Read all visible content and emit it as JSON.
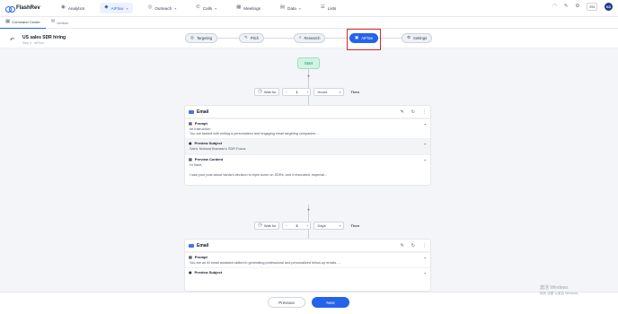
{
  "app": {
    "name": "FlashRev"
  },
  "nav": {
    "items": [
      {
        "label": "Analytics",
        "icon": "analytics-icon"
      },
      {
        "label": "AIFlow",
        "icon": "aiflow-icon"
      },
      {
        "label": "Outreach",
        "icon": "outreach-icon"
      },
      {
        "label": "Calls",
        "icon": "phone-icon"
      },
      {
        "label": "Meetings",
        "icon": "calendar-icon"
      },
      {
        "label": "Data",
        "icon": "data-icon"
      },
      {
        "label": "Lists",
        "icon": "list-icon"
      }
    ],
    "right": {
      "badge": "EN",
      "avatar": "KD"
    }
  },
  "subnav": {
    "tabs": [
      "Command Center",
      "Umbox"
    ]
  },
  "header": {
    "title": "US sales SDR hiring",
    "subtitle": "Step 4 · AIFlow"
  },
  "steps": [
    "Targeting",
    "Pitch",
    "Research",
    "AIFlow",
    "Settings"
  ],
  "flow": {
    "start_label": "Start",
    "waits": [
      {
        "prefix": "Wait for",
        "value": "1",
        "unit": "Hours",
        "suffix": "Then"
      },
      {
        "prefix": "Wait for",
        "value": "3",
        "unit": "Days",
        "suffix": "Then"
      }
    ],
    "cards": [
      {
        "title": "Email",
        "prompt_label": "Prompt",
        "prompt_line1": "## Instruction:",
        "prompt_line2": "You are tasked with writing a personalized and engaging email targeting companies ...",
        "subject_label": "Preview Subject",
        "subject_text": "Saint, Noboud Bravado's SDR Focus",
        "content_label": "Preview Content",
        "content_line1": "Hi Saint,",
        "content_line2": "I saw your post about Varda's decision to triple down on SDRs, and it resonated, especial..."
      },
      {
        "title": "Email",
        "prompt_label": "Prompt",
        "prompt_line1": "You are an AI email assistant skilled in generating professional and personalized follow-up emails. ...",
        "subject_label": "Preview Subject"
      }
    ]
  },
  "footer": {
    "previous": "Previous",
    "next": "Next"
  },
  "watermark": {
    "line1": "激活 Windows",
    "line2": "转到\"设置\"以激活 Windows。"
  },
  "colors": {
    "accent": "#2563eb",
    "highlight": "#dc2626",
    "start_bg": "#d1f3e4"
  }
}
